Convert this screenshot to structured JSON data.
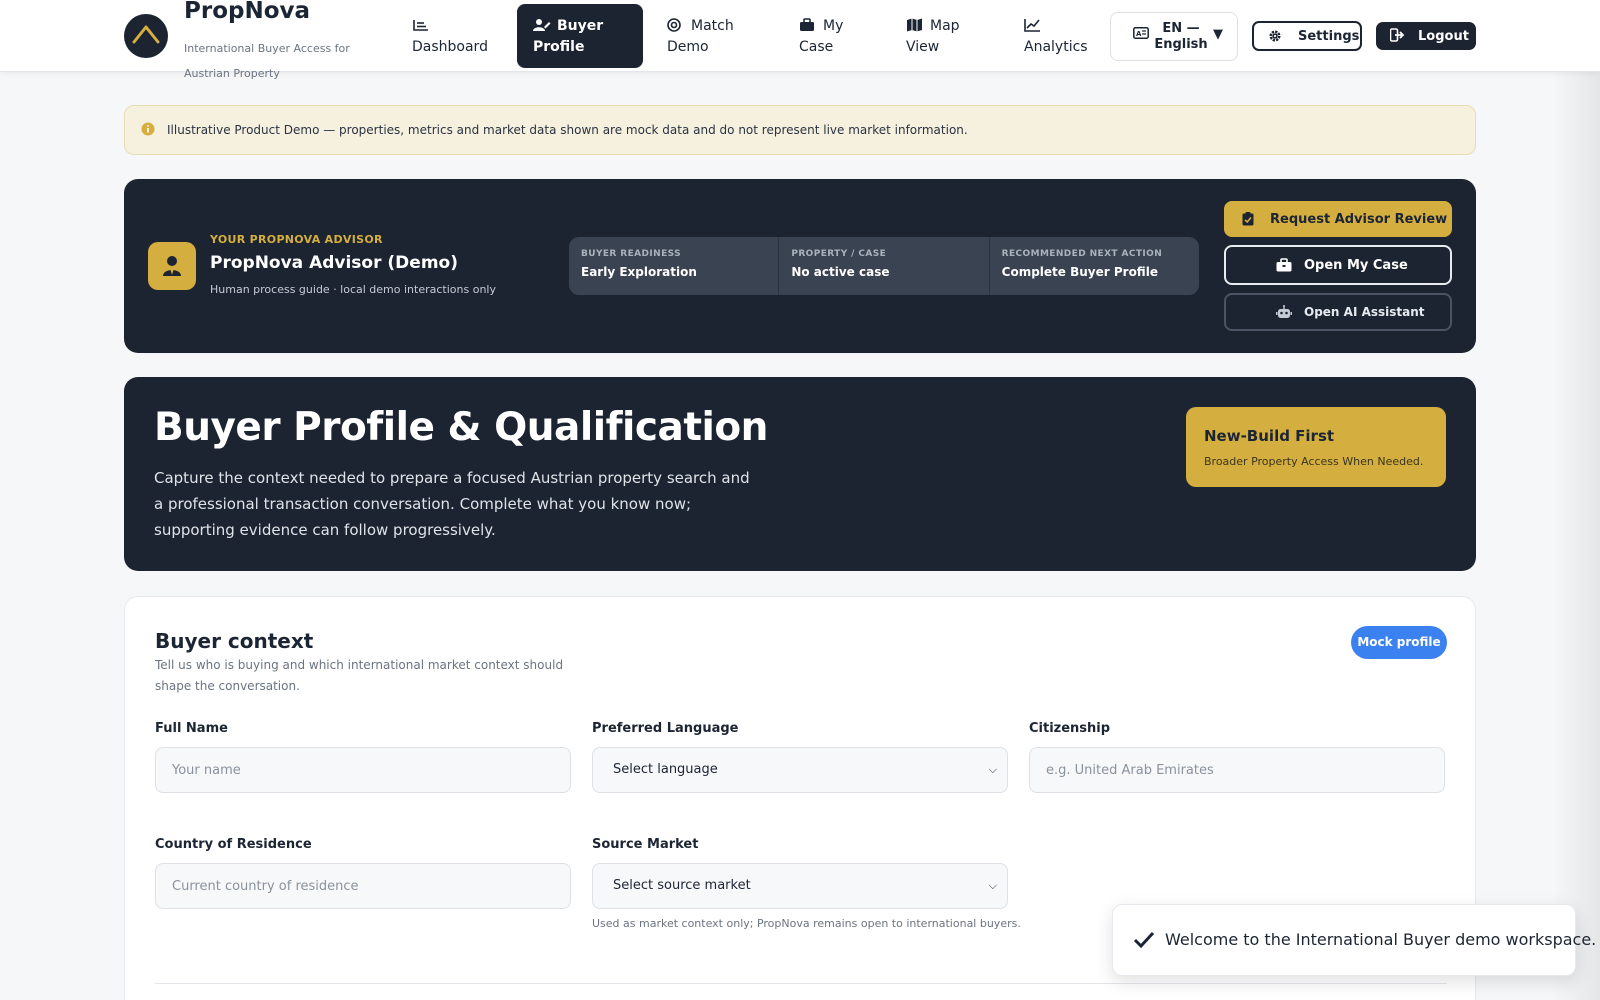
{
  "brand": {
    "name": "PropNova",
    "subtitle": "International Buyer Access for Austrian Property"
  },
  "nav": {
    "items": [
      {
        "label": "Dashboard",
        "icon": "list-icon"
      },
      {
        "label": "Buyer Profile",
        "icon": "user-edit-icon",
        "active": true
      },
      {
        "label": "Match Demo",
        "icon": "target-icon"
      },
      {
        "label": "My Case",
        "icon": "briefcase-icon"
      },
      {
        "label": "Map View",
        "icon": "map-icon"
      },
      {
        "label": "Analytics",
        "icon": "chart-line-icon"
      }
    ],
    "language": "EN — English",
    "settings_label": "Settings",
    "logout_label": "Logout"
  },
  "notice": {
    "text": "Illustrative Product Demo — properties, metrics and market data shown are mock data and do not represent live market information."
  },
  "advisor": {
    "kicker": "YOUR PROPNOVA ADVISOR",
    "name": "PropNova Advisor (Demo)",
    "subtitle": "Human process guide · local demo interactions only",
    "stats": [
      {
        "label": "BUYER READINESS",
        "value": "Early Exploration"
      },
      {
        "label": "PROPERTY / CASE",
        "value": "No active case"
      },
      {
        "label": "RECOMMENDED NEXT ACTION",
        "value": "Complete Buyer Profile"
      }
    ],
    "buttons": {
      "review": "Request Advisor Review",
      "case": "Open My Case",
      "ai": "Open AI Assistant"
    }
  },
  "hero": {
    "title": "Buyer Profile & Qualification",
    "description": "Capture the context needed to prepare a focused Austrian property search and a professional transaction conversation. Complete what you know now; supporting evidence can follow progressively.",
    "badge_title": "New-Build First",
    "badge_subtitle": "Broader Property Access When Needed."
  },
  "form": {
    "section_title": "Buyer context",
    "section_desc": "Tell us who is buying and which international market context should shape the conversation.",
    "badge": "Mock profile",
    "full_name": {
      "label": "Full Name",
      "placeholder": "Your name",
      "value": ""
    },
    "preferred_language": {
      "label": "Preferred Language",
      "value": "Select language"
    },
    "citizenship": {
      "label": "Citizenship",
      "placeholder": "e.g. United Arab Emirates",
      "value": ""
    },
    "country_of_residence": {
      "label": "Country of Residence",
      "placeholder": "Current country of residence",
      "value": ""
    },
    "source_market": {
      "label": "Source Market",
      "value": "Select source market",
      "help": "Used as market context only; PropNova remains open to international buyers."
    }
  },
  "toast": {
    "message": "Welcome to the International Buyer demo workspace."
  },
  "colors": {
    "navy": "#1d2431",
    "gold": "#d4ae3e",
    "blue": "#3b82f0",
    "notice_bg": "#f6f0df"
  }
}
